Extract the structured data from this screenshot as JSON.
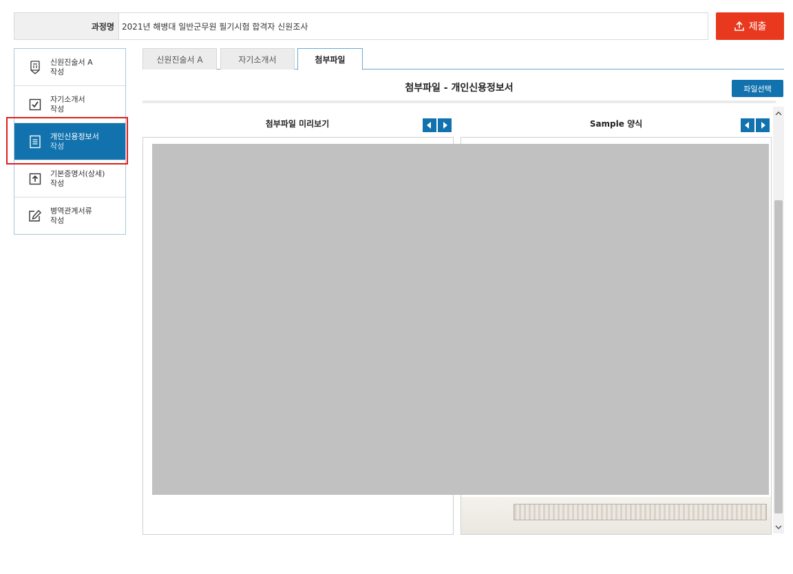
{
  "header": {
    "course_label": "과정명",
    "course_value": "2021년 해병대 일반군무원 필기시험 합격자 신원조사",
    "submit_label": "제출"
  },
  "sidebar": {
    "items": [
      {
        "title": "신원진술서 A",
        "sub": "작성",
        "icon": "document-shield-icon"
      },
      {
        "title": "자기소개서",
        "sub": "작성",
        "icon": "checkbox-icon"
      },
      {
        "title": "개인신용정보서",
        "sub": "작성",
        "icon": "list-document-icon",
        "active": true
      },
      {
        "title": "기본증명서(상세)",
        "sub": "작성",
        "icon": "upload-icon"
      },
      {
        "title": "병역관계서류",
        "sub": "작성",
        "icon": "edit-icon"
      }
    ]
  },
  "tabs": [
    {
      "label": "신원진술서 A"
    },
    {
      "label": "자기소개서"
    },
    {
      "label": "첨부파일",
      "active": true
    }
  ],
  "main": {
    "title": "첨부파일 - 개인신용정보서",
    "file_select_label": "파일선택",
    "preview_title": "첨부파일 미리보기",
    "sample_title": "Sample 양식"
  },
  "colors": {
    "primary": "#1272ae",
    "submit": "#e8381e",
    "highlight": "#e01b1b",
    "preview_grey": "#c1c1c1"
  }
}
